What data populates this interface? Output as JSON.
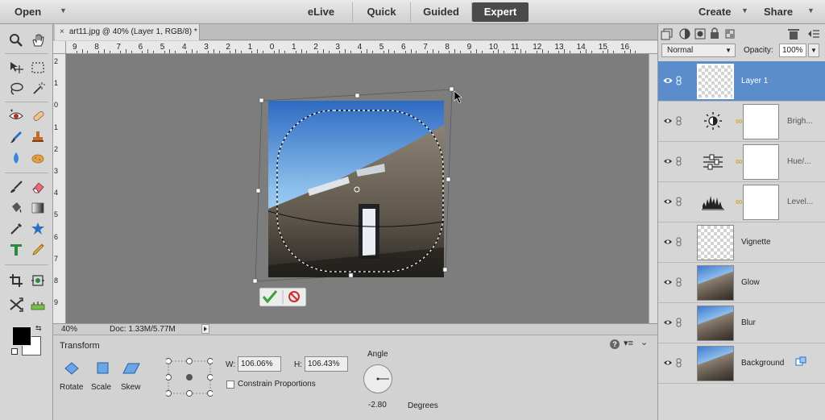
{
  "topbar": {
    "open_label": "Open",
    "modes": [
      "eLive",
      "Quick",
      "Guided",
      "Expert"
    ],
    "active_mode": "Expert",
    "create_label": "Create",
    "share_label": "Share"
  },
  "document": {
    "tab_title": "art11.jpg @ 40% (Layer 1, RGB/8) *",
    "close_glyph": "×"
  },
  "ruler": {
    "top_labels": [
      "9",
      "8",
      "7",
      "6",
      "5",
      "4",
      "3",
      "2",
      "1",
      "0",
      "1",
      "2",
      "3",
      "4",
      "5",
      "6",
      "7",
      "8",
      "9",
      "10",
      "11",
      "12",
      "13",
      "14",
      "15",
      "16"
    ],
    "left_labels": [
      "2",
      "1",
      "0",
      "1",
      "2",
      "3",
      "4",
      "5",
      "6",
      "7",
      "8",
      "9"
    ]
  },
  "status": {
    "zoom": "40%",
    "doc_size": "Doc: 1.33M/5.77M"
  },
  "options": {
    "title": "Transform",
    "buttons": [
      "Rotate",
      "Scale",
      "Skew"
    ],
    "w_label": "W:",
    "w_value": "106.06%",
    "h_label": "H:",
    "h_value": "106.43%",
    "constrain_label": "Constrain Proportions",
    "angle_label": "Angle",
    "angle_value": "-2.80",
    "angle_unit": "Degrees"
  },
  "layers_panel": {
    "blend_mode": "Normal",
    "opacity_label": "Opacity:",
    "opacity_value": "100%",
    "layers": [
      {
        "name": "Layer 1",
        "kind": "transparent",
        "selected": true
      },
      {
        "name": "Brigh...",
        "kind": "adjustment",
        "icon": "brightness-icon"
      },
      {
        "name": "Hue/...",
        "kind": "adjustment",
        "icon": "hue-saturation-icon"
      },
      {
        "name": "Level...",
        "kind": "adjustment",
        "icon": "levels-icon"
      },
      {
        "name": "Vignette",
        "kind": "transparent"
      },
      {
        "name": "Glow",
        "kind": "photo"
      },
      {
        "name": "Blur",
        "kind": "photo"
      },
      {
        "name": "Background",
        "kind": "photo"
      }
    ]
  },
  "colors": {
    "accent": "#5b8ccb",
    "canvas": "#7d7d7d",
    "commit_green": "#3aa03a",
    "cancel_red": "#cc2b2b"
  }
}
